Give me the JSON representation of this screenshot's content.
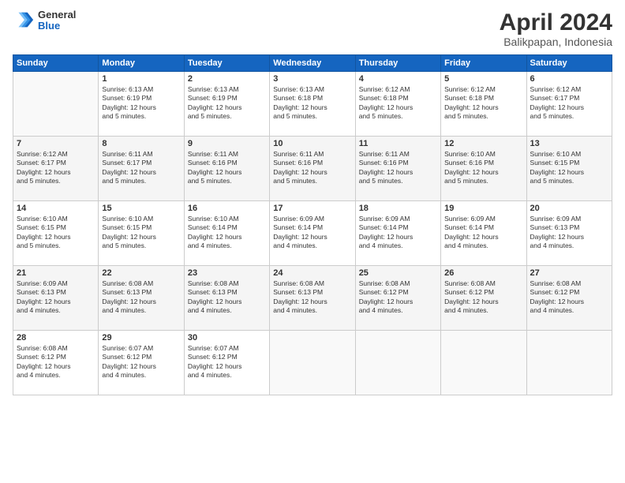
{
  "logo": {
    "general": "General",
    "blue": "Blue"
  },
  "title": "April 2024",
  "location": "Balikpapan, Indonesia",
  "weekdays": [
    "Sunday",
    "Monday",
    "Tuesday",
    "Wednesday",
    "Thursday",
    "Friday",
    "Saturday"
  ],
  "weeks": [
    [
      {
        "day": "",
        "info": ""
      },
      {
        "day": "1",
        "info": "Sunrise: 6:13 AM\nSunset: 6:19 PM\nDaylight: 12 hours\nand 5 minutes."
      },
      {
        "day": "2",
        "info": "Sunrise: 6:13 AM\nSunset: 6:19 PM\nDaylight: 12 hours\nand 5 minutes."
      },
      {
        "day": "3",
        "info": "Sunrise: 6:13 AM\nSunset: 6:18 PM\nDaylight: 12 hours\nand 5 minutes."
      },
      {
        "day": "4",
        "info": "Sunrise: 6:12 AM\nSunset: 6:18 PM\nDaylight: 12 hours\nand 5 minutes."
      },
      {
        "day": "5",
        "info": "Sunrise: 6:12 AM\nSunset: 6:18 PM\nDaylight: 12 hours\nand 5 minutes."
      },
      {
        "day": "6",
        "info": "Sunrise: 6:12 AM\nSunset: 6:17 PM\nDaylight: 12 hours\nand 5 minutes."
      }
    ],
    [
      {
        "day": "7",
        "info": "Sunrise: 6:12 AM\nSunset: 6:17 PM\nDaylight: 12 hours\nand 5 minutes."
      },
      {
        "day": "8",
        "info": "Sunrise: 6:11 AM\nSunset: 6:17 PM\nDaylight: 12 hours\nand 5 minutes."
      },
      {
        "day": "9",
        "info": "Sunrise: 6:11 AM\nSunset: 6:16 PM\nDaylight: 12 hours\nand 5 minutes."
      },
      {
        "day": "10",
        "info": "Sunrise: 6:11 AM\nSunset: 6:16 PM\nDaylight: 12 hours\nand 5 minutes."
      },
      {
        "day": "11",
        "info": "Sunrise: 6:11 AM\nSunset: 6:16 PM\nDaylight: 12 hours\nand 5 minutes."
      },
      {
        "day": "12",
        "info": "Sunrise: 6:10 AM\nSunset: 6:16 PM\nDaylight: 12 hours\nand 5 minutes."
      },
      {
        "day": "13",
        "info": "Sunrise: 6:10 AM\nSunset: 6:15 PM\nDaylight: 12 hours\nand 5 minutes."
      }
    ],
    [
      {
        "day": "14",
        "info": "Sunrise: 6:10 AM\nSunset: 6:15 PM\nDaylight: 12 hours\nand 5 minutes."
      },
      {
        "day": "15",
        "info": "Sunrise: 6:10 AM\nSunset: 6:15 PM\nDaylight: 12 hours\nand 5 minutes."
      },
      {
        "day": "16",
        "info": "Sunrise: 6:10 AM\nSunset: 6:14 PM\nDaylight: 12 hours\nand 4 minutes."
      },
      {
        "day": "17",
        "info": "Sunrise: 6:09 AM\nSunset: 6:14 PM\nDaylight: 12 hours\nand 4 minutes."
      },
      {
        "day": "18",
        "info": "Sunrise: 6:09 AM\nSunset: 6:14 PM\nDaylight: 12 hours\nand 4 minutes."
      },
      {
        "day": "19",
        "info": "Sunrise: 6:09 AM\nSunset: 6:14 PM\nDaylight: 12 hours\nand 4 minutes."
      },
      {
        "day": "20",
        "info": "Sunrise: 6:09 AM\nSunset: 6:13 PM\nDaylight: 12 hours\nand 4 minutes."
      }
    ],
    [
      {
        "day": "21",
        "info": "Sunrise: 6:09 AM\nSunset: 6:13 PM\nDaylight: 12 hours\nand 4 minutes."
      },
      {
        "day": "22",
        "info": "Sunrise: 6:08 AM\nSunset: 6:13 PM\nDaylight: 12 hours\nand 4 minutes."
      },
      {
        "day": "23",
        "info": "Sunrise: 6:08 AM\nSunset: 6:13 PM\nDaylight: 12 hours\nand 4 minutes."
      },
      {
        "day": "24",
        "info": "Sunrise: 6:08 AM\nSunset: 6:13 PM\nDaylight: 12 hours\nand 4 minutes."
      },
      {
        "day": "25",
        "info": "Sunrise: 6:08 AM\nSunset: 6:12 PM\nDaylight: 12 hours\nand 4 minutes."
      },
      {
        "day": "26",
        "info": "Sunrise: 6:08 AM\nSunset: 6:12 PM\nDaylight: 12 hours\nand 4 minutes."
      },
      {
        "day": "27",
        "info": "Sunrise: 6:08 AM\nSunset: 6:12 PM\nDaylight: 12 hours\nand 4 minutes."
      }
    ],
    [
      {
        "day": "28",
        "info": "Sunrise: 6:08 AM\nSunset: 6:12 PM\nDaylight: 12 hours\nand 4 minutes."
      },
      {
        "day": "29",
        "info": "Sunrise: 6:07 AM\nSunset: 6:12 PM\nDaylight: 12 hours\nand 4 minutes."
      },
      {
        "day": "30",
        "info": "Sunrise: 6:07 AM\nSunset: 6:12 PM\nDaylight: 12 hours\nand 4 minutes."
      },
      {
        "day": "",
        "info": ""
      },
      {
        "day": "",
        "info": ""
      },
      {
        "day": "",
        "info": ""
      },
      {
        "day": "",
        "info": ""
      }
    ]
  ]
}
